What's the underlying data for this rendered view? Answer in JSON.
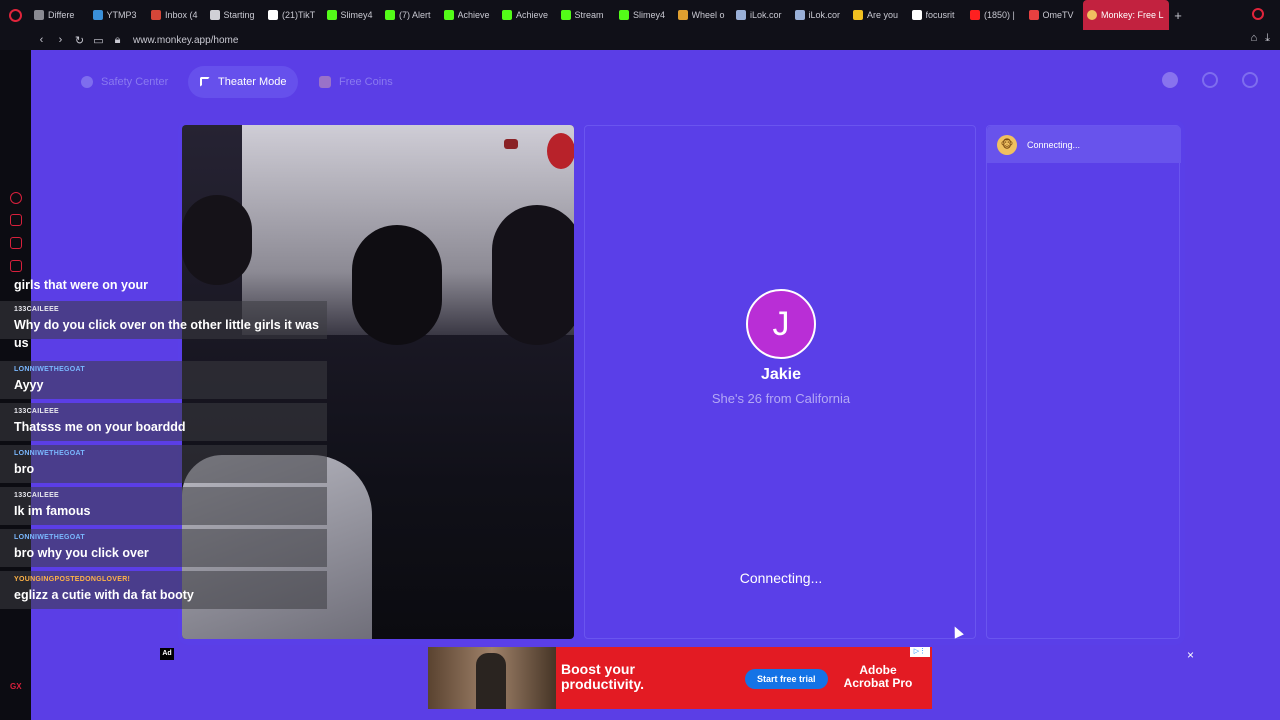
{
  "browser": {
    "tabs": [
      {
        "label": "Differe",
        "color": "#8a8a92"
      },
      {
        "label": "YTMP3",
        "color": "#3a8fd8"
      },
      {
        "label": "Inbox (4",
        "color": "#d44638"
      },
      {
        "label": "Starting",
        "color": "#d0d0d6"
      },
      {
        "label": "(21)TikT",
        "color": "#ffffff"
      },
      {
        "label": "Slimey4",
        "color": "#53fc18"
      },
      {
        "label": "(7) Alert",
        "color": "#53fc18"
      },
      {
        "label": "Achieve",
        "color": "#53fc18"
      },
      {
        "label": "Achieve",
        "color": "#53fc18"
      },
      {
        "label": "Stream",
        "color": "#53fc18"
      },
      {
        "label": "Slimey4",
        "color": "#53fc18"
      },
      {
        "label": "Wheel o",
        "color": "#e0a030"
      },
      {
        "label": "iLok.cor",
        "color": "#9ab0d8"
      },
      {
        "label": "iLok.cor",
        "color": "#9ab0d8"
      },
      {
        "label": "Are you",
        "color": "#f0c020"
      },
      {
        "label": "focusrit",
        "color": "#ffffff"
      },
      {
        "label": "(1850) |",
        "color": "#ff2020"
      },
      {
        "label": "OmeTV",
        "color": "#e84040"
      }
    ],
    "active_tab": {
      "label": "Monkey: Free L",
      "color": "#f0c060"
    },
    "url": "www.monkey.app/home"
  },
  "page": {
    "pills": {
      "safety": "Safety Center",
      "theater": "Theater Mode",
      "coins": "Free Coins"
    },
    "profile": {
      "initial": "J",
      "name": "Jakie",
      "info": "She's 26 from California",
      "status": "Connecting..."
    },
    "chat": {
      "status": "Connecting..."
    },
    "ad": {
      "label": "Ad",
      "headline": "Boost your productivity.",
      "cta": "Start free trial",
      "brand": "Adobe Acrobat Pro",
      "close": "×"
    }
  },
  "stream_chat": [
    {
      "user": "",
      "msg": "girls that were on your",
      "user_color": "#e8e8ee"
    },
    {
      "user": "133CAILEEE",
      "msg": "Why do you click over on the other little girls it was us",
      "user_color": "#e8e8ee"
    },
    {
      "user": "LONNIWETHEGOAT",
      "msg": "Ayyy",
      "user_color": "#7ab8ff"
    },
    {
      "user": "133CAILEEE",
      "msg": "Thatsss me on your boarddd",
      "user_color": "#e8e8ee"
    },
    {
      "user": "LONNIWETHEGOAT",
      "msg": "bro",
      "user_color": "#7ab8ff"
    },
    {
      "user": "133CAILEEE",
      "msg": "Ik im famous",
      "user_color": "#e8e8ee"
    },
    {
      "user": "LONNIWETHEGOAT",
      "msg": "bro why you click over",
      "user_color": "#7ab8ff"
    },
    {
      "user": "YOUNGINGPOSTEDONGLOVER!",
      "msg": "eglizz a cutie with da fat booty",
      "user_color": "#ffb347"
    }
  ]
}
